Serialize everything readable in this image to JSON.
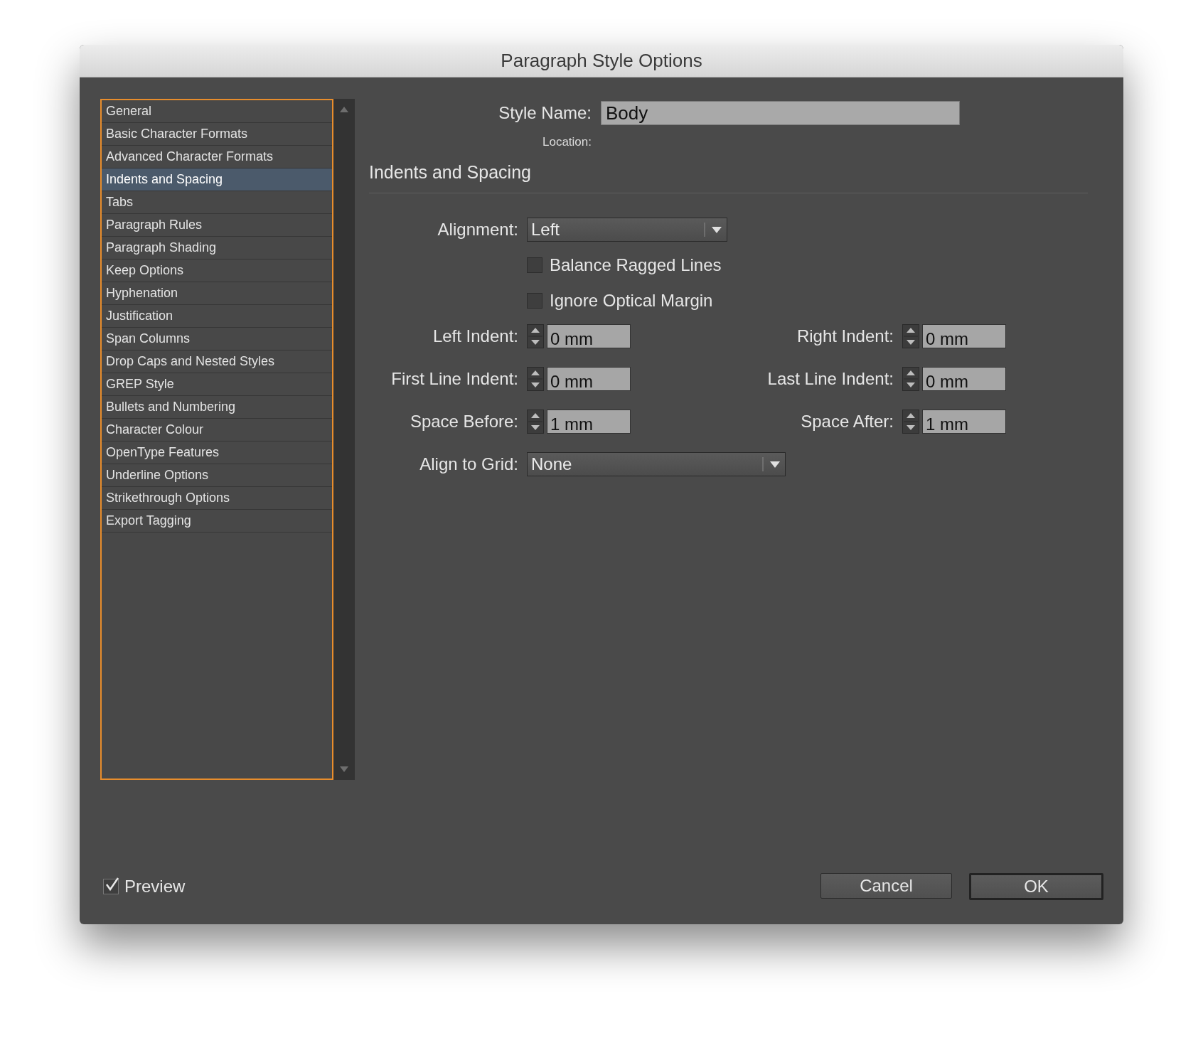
{
  "window": {
    "title": "Paragraph Style Options"
  },
  "sidebar": {
    "items": [
      {
        "label": "General",
        "selected": false
      },
      {
        "label": "Basic Character Formats",
        "selected": false
      },
      {
        "label": "Advanced Character Formats",
        "selected": false
      },
      {
        "label": "Indents and Spacing",
        "selected": true
      },
      {
        "label": "Tabs",
        "selected": false
      },
      {
        "label": "Paragraph Rules",
        "selected": false
      },
      {
        "label": "Paragraph Shading",
        "selected": false
      },
      {
        "label": "Keep Options",
        "selected": false
      },
      {
        "label": "Hyphenation",
        "selected": false
      },
      {
        "label": "Justification",
        "selected": false
      },
      {
        "label": "Span Columns",
        "selected": false
      },
      {
        "label": "Drop Caps and Nested Styles",
        "selected": false
      },
      {
        "label": "GREP Style",
        "selected": false
      },
      {
        "label": "Bullets and Numbering",
        "selected": false
      },
      {
        "label": "Character Colour",
        "selected": false
      },
      {
        "label": "OpenType Features",
        "selected": false
      },
      {
        "label": "Underline Options",
        "selected": false
      },
      {
        "label": "Strikethrough Options",
        "selected": false
      },
      {
        "label": "Export Tagging",
        "selected": false
      }
    ]
  },
  "style_name": {
    "label": "Style Name:",
    "value": "Body"
  },
  "location": {
    "label": "Location:"
  },
  "section_title": "Indents and Spacing",
  "fields": [
    {
      "kind": "dropdown",
      "label": "Alignment:",
      "value": "Left"
    },
    {
      "kind": "checkbox",
      "label": "Balance Ragged Lines",
      "checked": false
    },
    {
      "kind": "checkbox",
      "label": "Ignore Optical Margin",
      "checked": false
    },
    {
      "kind": "spinner_pair",
      "left": {
        "label": "Left Indent:",
        "value": "0 mm"
      },
      "right": {
        "label": "Right Indent:",
        "value": "0 mm"
      }
    },
    {
      "kind": "spinner_pair",
      "left": {
        "label": "First Line Indent:",
        "value": "0 mm"
      },
      "right": {
        "label": "Last Line Indent:",
        "value": "0 mm"
      }
    },
    {
      "kind": "spinner_pair",
      "left": {
        "label": "Space Before:",
        "value": "1 mm"
      },
      "right": {
        "label": "Space After:",
        "value": "1 mm"
      }
    },
    {
      "kind": "dropdown",
      "label": "Align to Grid:",
      "value": "None"
    }
  ],
  "preview": {
    "label": "Preview",
    "checked": true
  },
  "buttons": [
    {
      "label": "Cancel",
      "default": false
    },
    {
      "label": "OK",
      "default": true
    }
  ]
}
